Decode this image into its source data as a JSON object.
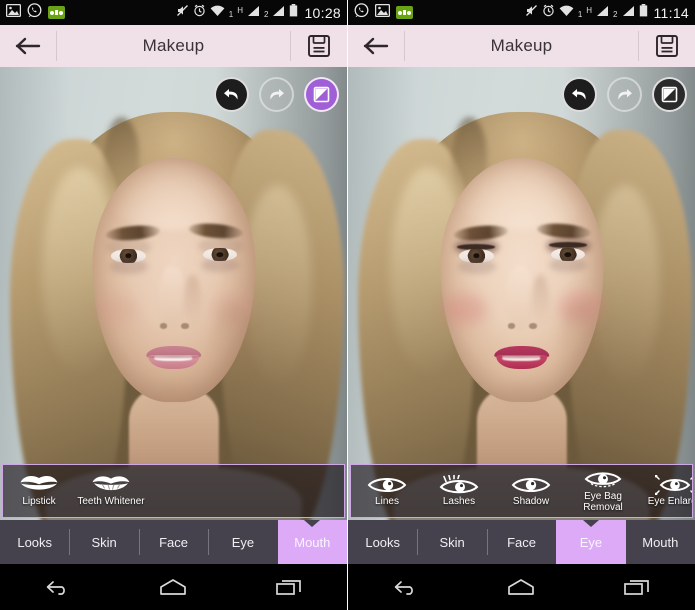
{
  "app": {
    "title": "Makeup",
    "accent_purple": "#dcaaf7",
    "titlebar_color": "#f0e1e8",
    "tabbar_color": "#45414d",
    "strip_border": "#cfa6e6",
    "compare_active_color": "#a05fd6"
  },
  "panels": [
    {
      "id": "before",
      "statusbar": {
        "left_icons": [
          "image-icon",
          "whatsapp-icon",
          "voicemail-icon"
        ],
        "right_icons": [
          "mute-icon",
          "alarm-icon",
          "wifi-icon",
          "hspa-icon",
          "signal-icon",
          "signal-icon",
          "battery-icon"
        ],
        "wifi_label": "1",
        "network_label": "H",
        "sim_label": "2",
        "clock": "10:28"
      },
      "titlebar": {
        "back_label": "back-arrow",
        "title": "Makeup",
        "save_label": "save"
      },
      "actions": {
        "undo": "undo",
        "redo": "redo",
        "compare": "compare",
        "undo_enabled": "true",
        "redo_enabled": "false",
        "compare_active": "true"
      },
      "tools": [
        {
          "label": "Lipstick",
          "icon": "lips-icon"
        },
        {
          "label": "Teeth Whitener",
          "icon": "teeth-icon"
        }
      ],
      "tabs": [
        {
          "label": "Looks",
          "active": false
        },
        {
          "label": "Skin",
          "active": false
        },
        {
          "label": "Face",
          "active": false
        },
        {
          "label": "Eye",
          "active": false
        },
        {
          "label": "Mouth",
          "active": true
        }
      ],
      "navbar": [
        "back-nav-icon",
        "home-nav-icon",
        "recents-nav-icon"
      ]
    },
    {
      "id": "after",
      "statusbar": {
        "left_icons": [
          "whatsapp-icon",
          "image-icon",
          "voicemail-icon"
        ],
        "right_icons": [
          "mute-icon",
          "alarm-icon",
          "wifi-icon",
          "hspa-icon",
          "signal-icon",
          "signal-icon",
          "battery-icon"
        ],
        "wifi_label": "1",
        "network_label": "H",
        "sim_label": "2",
        "clock": "11:14"
      },
      "titlebar": {
        "back_label": "back-arrow",
        "title": "Makeup",
        "save_label": "save"
      },
      "actions": {
        "undo": "undo",
        "redo": "redo",
        "compare": "compare",
        "undo_enabled": "true",
        "redo_enabled": "false",
        "compare_active": "false"
      },
      "tools": [
        {
          "label": "Lines",
          "icon": "eye-icon"
        },
        {
          "label": "Lashes",
          "icon": "eye-lashes-icon"
        },
        {
          "label": "Shadow",
          "icon": "eye-icon"
        },
        {
          "label": "Eye Bag Removal",
          "icon": "eye-bag-icon"
        },
        {
          "label": "Eye Enlarge",
          "icon": "eye-enlarge-icon"
        }
      ],
      "tabs": [
        {
          "label": "Looks",
          "active": false
        },
        {
          "label": "Skin",
          "active": false
        },
        {
          "label": "Face",
          "active": false
        },
        {
          "label": "Eye",
          "active": true
        },
        {
          "label": "Mouth",
          "active": false
        }
      ],
      "navbar": [
        "back-nav-icon",
        "home-nav-icon",
        "recents-nav-icon"
      ]
    }
  ]
}
